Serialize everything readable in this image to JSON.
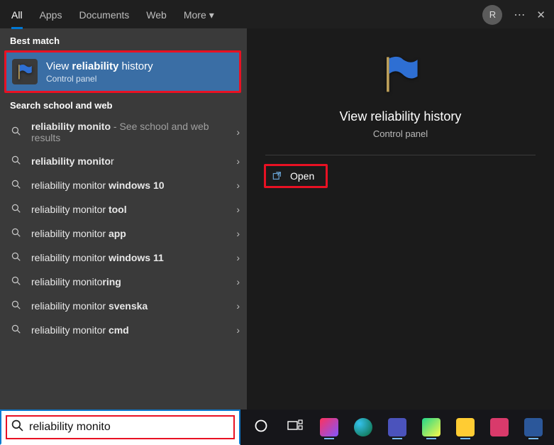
{
  "tabs": {
    "all": "All",
    "apps": "Apps",
    "documents": "Documents",
    "web": "Web",
    "more": "More"
  },
  "avatar_letter": "R",
  "sections": {
    "best_match": "Best match",
    "search_web": "Search school and web"
  },
  "best_match": {
    "title_prefix": "View ",
    "title_bold": "reliability",
    "title_suffix": " history",
    "subtitle": "Control panel"
  },
  "suggestions": [
    {
      "pre": "",
      "bold": "reliability monito",
      "post": "",
      "hint": " - See school and web results"
    },
    {
      "pre": "",
      "bold": "reliability monito",
      "post": "r",
      "hint": ""
    },
    {
      "pre": "reliability monitor ",
      "bold": "windows 10",
      "post": "",
      "hint": ""
    },
    {
      "pre": "reliability monitor ",
      "bold": "tool",
      "post": "",
      "hint": ""
    },
    {
      "pre": "reliability monitor ",
      "bold": "app",
      "post": "",
      "hint": ""
    },
    {
      "pre": "reliability monitor ",
      "bold": "windows 11",
      "post": "",
      "hint": ""
    },
    {
      "pre": "reliability monito",
      "bold": "ring",
      "post": "",
      "hint": ""
    },
    {
      "pre": "reliability monitor ",
      "bold": "svenska",
      "post": "",
      "hint": ""
    },
    {
      "pre": "reliability monitor ",
      "bold": "cmd",
      "post": "",
      "hint": ""
    }
  ],
  "detail": {
    "title": "View reliability history",
    "subtitle": "Control panel",
    "open_label": "Open"
  },
  "search": {
    "value": "reliability monito"
  },
  "taskbar": {
    "cortana": "cortana",
    "taskview": "task-view",
    "apps": [
      "intellij",
      "edge",
      "teams",
      "pycharm",
      "explorer",
      "snip",
      "word"
    ]
  },
  "colors": {
    "accent": "#0078d4",
    "highlight": "#e81123",
    "bestmatch_bg": "#3a6ea5"
  }
}
